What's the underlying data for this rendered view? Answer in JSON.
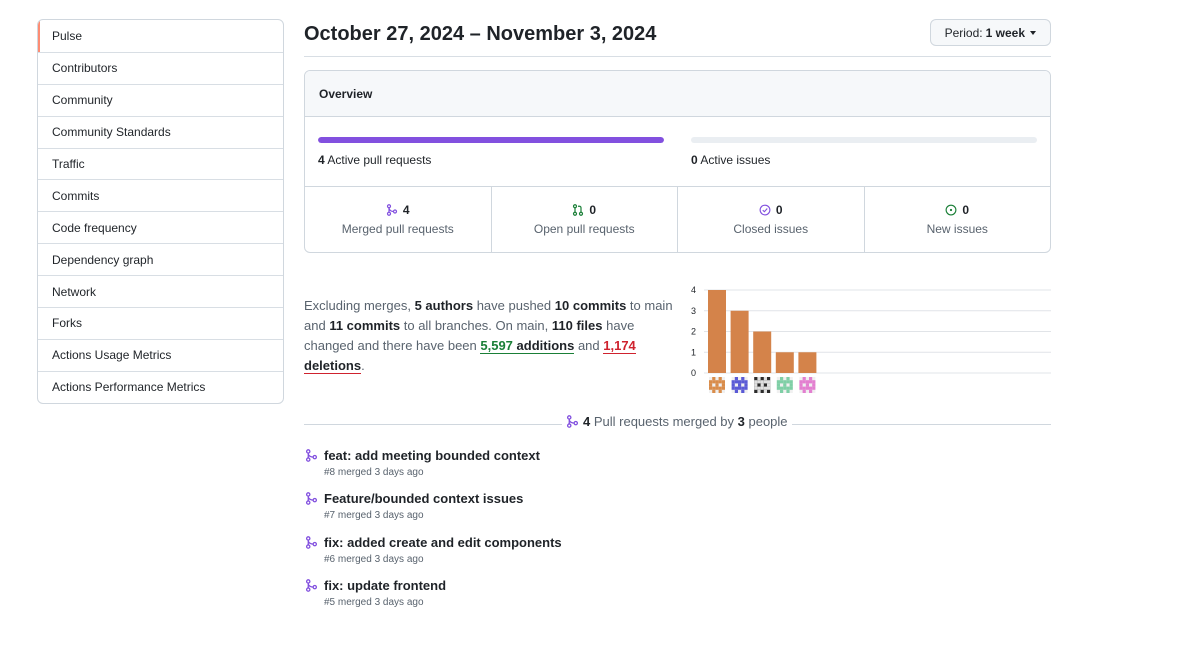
{
  "sidebar": {
    "items": [
      {
        "label": "Pulse",
        "selected": true
      },
      {
        "label": "Contributors"
      },
      {
        "label": "Community"
      },
      {
        "label": "Community Standards"
      },
      {
        "label": "Traffic"
      },
      {
        "label": "Commits"
      },
      {
        "label": "Code frequency"
      },
      {
        "label": "Dependency graph"
      },
      {
        "label": "Network"
      },
      {
        "label": "Forks"
      },
      {
        "label": "Actions Usage Metrics"
      },
      {
        "label": "Actions Performance Metrics"
      }
    ]
  },
  "header": {
    "date_range": "October 27, 2024 – November 3, 2024",
    "period_label": "Period:",
    "period_value": "1 week"
  },
  "overview": {
    "title": "Overview",
    "pull_requests": {
      "count": "4",
      "label": "Active pull requests",
      "fill_fraction": 1.0
    },
    "issues": {
      "count": "0",
      "label": "Active issues",
      "fill_fraction": 0.0
    },
    "stats": [
      {
        "value": "4",
        "label": "Merged pull requests",
        "icon": "merged-pr-icon",
        "color": "#8250df"
      },
      {
        "value": "0",
        "label": "Open pull requests",
        "icon": "open-pr-icon",
        "color": "#1a7f37"
      },
      {
        "value": "0",
        "label": "Closed issues",
        "icon": "closed-issue-icon",
        "color": "#8250df"
      },
      {
        "value": "0",
        "label": "New issues",
        "icon": "new-issue-icon",
        "color": "#1a7f37"
      }
    ]
  },
  "summary": {
    "t1": "Excluding merges, ",
    "authors": "5 authors",
    "t2": " have pushed ",
    "commits_main": "10 commits",
    "t3": " to main and ",
    "commits_all": "11 commits",
    "t4": " to all branches. On main, ",
    "files": "110 files",
    "t5": " have changed and there have been ",
    "additions_num": "5,597",
    "additions_word": "additions",
    "t6": " and ",
    "deletions_num": "1,174",
    "deletions_word": "deletions",
    "t7": "."
  },
  "chart_data": {
    "type": "bar",
    "categories": [
      "author-1",
      "author-2",
      "author-3",
      "author-4",
      "author-5"
    ],
    "values": [
      4,
      3,
      2,
      1,
      1
    ],
    "ylim": [
      0,
      4
    ],
    "yticks": [
      "4",
      "3",
      "2",
      "1",
      "0"
    ],
    "bar_color": "#d4834a",
    "grid": true,
    "avatar_colors": [
      "#d98c4a",
      "#5a5ad6",
      "#2b2b2b",
      "#7fcfa6",
      "#e37fd0"
    ]
  },
  "merged": {
    "count": "4",
    "t1": " Pull requests merged by ",
    "people": "3",
    "t2": " people"
  },
  "pull_requests": [
    {
      "title": "feat: add meeting bounded context",
      "meta": "#8 merged 3 days ago"
    },
    {
      "title": "Feature/bounded context issues",
      "meta": "#7 merged 3 days ago"
    },
    {
      "title": "fix: added create and edit components",
      "meta": "#6 merged 3 days ago"
    },
    {
      "title": "fix: update frontend",
      "meta": "#5 merged 3 days ago"
    }
  ]
}
